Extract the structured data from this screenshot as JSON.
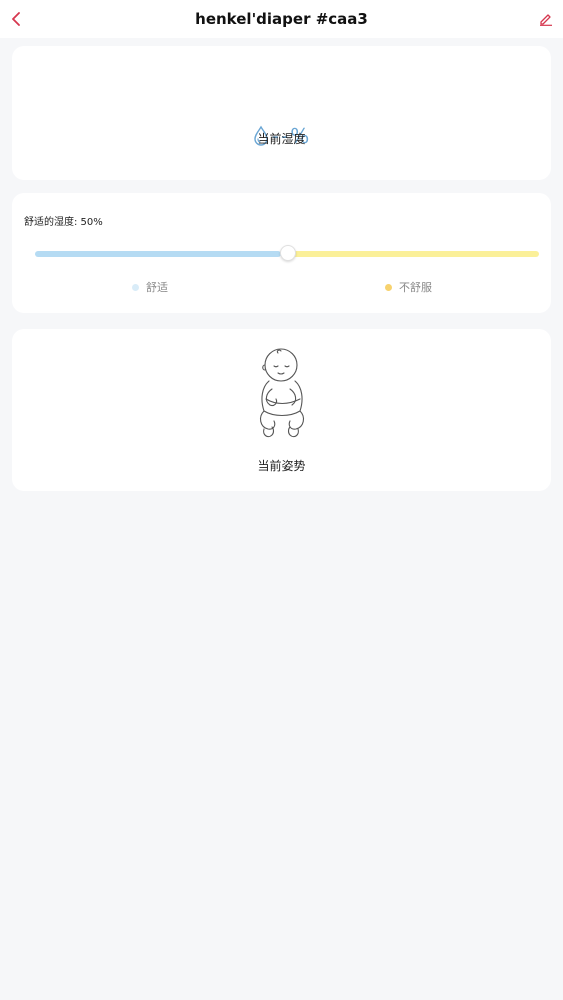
{
  "header": {
    "title": "henkel'diaper #caa3",
    "back_icon": "chevron-left-icon",
    "edit_icon": "pencil-icon",
    "accent_color": "#d6374f"
  },
  "humidity": {
    "value": "--%",
    "label": "当前湿度",
    "icon": "water-drop-icon",
    "value_color": "#6aa6d4"
  },
  "comfort": {
    "label": "舒适的湿度: 50%",
    "slider_value": 0.5,
    "legend": [
      {
        "label": "舒适",
        "color": "#d9ecf8"
      },
      {
        "label": "不舒服",
        "color": "#f7d26e"
      }
    ]
  },
  "posture": {
    "label": "当前姿势",
    "icon": "baby-sitting-icon"
  }
}
